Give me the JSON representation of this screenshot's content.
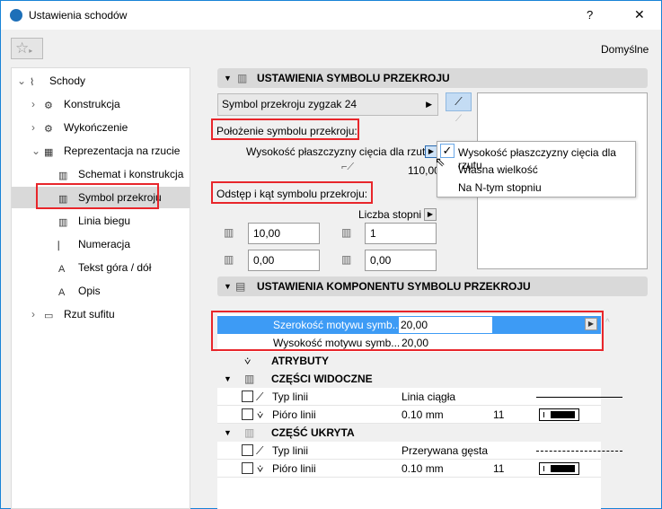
{
  "window": {
    "title": "Ustawienia schodów",
    "help": "?",
    "close": "✕"
  },
  "toolbar": {
    "favorites_icon": "star-icon",
    "default_label": "Domyślne"
  },
  "tree": [
    {
      "label": "Schody",
      "level": 0,
      "expanded": true
    },
    {
      "label": "Konstrukcja",
      "level": 1
    },
    {
      "label": "Wykończenie",
      "level": 1
    },
    {
      "label": "Reprezentacja na rzucie",
      "level": 1,
      "expanded": true
    },
    {
      "label": "Schemat i konstrukcja",
      "level": 2
    },
    {
      "label": "Symbol przekroju",
      "level": 2,
      "selected": true
    },
    {
      "label": "Linia biegu",
      "level": 2
    },
    {
      "label": "Numeracja",
      "level": 2
    },
    {
      "label": "Tekst góra / dół",
      "level": 2
    },
    {
      "label": "Opis",
      "level": 2
    },
    {
      "label": "Rzut sufitu",
      "level": 1
    }
  ],
  "section1": {
    "title": "USTAWIENIA SYMBOLU PRZEKROJU",
    "symbol_select": "Symbol przekroju zygzak 24",
    "position_label": "Położenie symbolu przekroju:",
    "position_value": "Wysokość płaszczyzny cięcia dla rzutu",
    "height_value": "110,00",
    "spacing_label": "Odstęp i kąt symbolu przekroju:",
    "steps_label": "Liczba stopni",
    "field1": "10,00",
    "field2": "1",
    "field3": "0,00",
    "field4": "0,00"
  },
  "dropdown": {
    "options": [
      "Wysokość płaszczyzny cięcia dla rzutu",
      "Własna wielkość",
      "Na N-tym stopniu"
    ],
    "checked": 0
  },
  "section2": {
    "title": "USTAWIENIA KOMPONENTU SYMBOLU PRZEKROJU",
    "width_label": "Szerokość motywu symb...",
    "width_value": "20,00",
    "height_label": "Wysokość motywu symb...",
    "height_value": "20,00",
    "attributes": "ATRYBUTY",
    "visible": "CZĘŚCI WIDOCZNE",
    "hidden": "CZĘŚĆ UKRYTA",
    "line_type": "Typ linii",
    "pen": "Pióro linii",
    "visible_line": "Linia ciągła",
    "hidden_line": "Przerywana gęsta",
    "pen_size": "0.10 mm",
    "pen_num": "11"
  },
  "colors": {
    "accent": "#3d9bf5",
    "highlight": "#e8262b"
  }
}
